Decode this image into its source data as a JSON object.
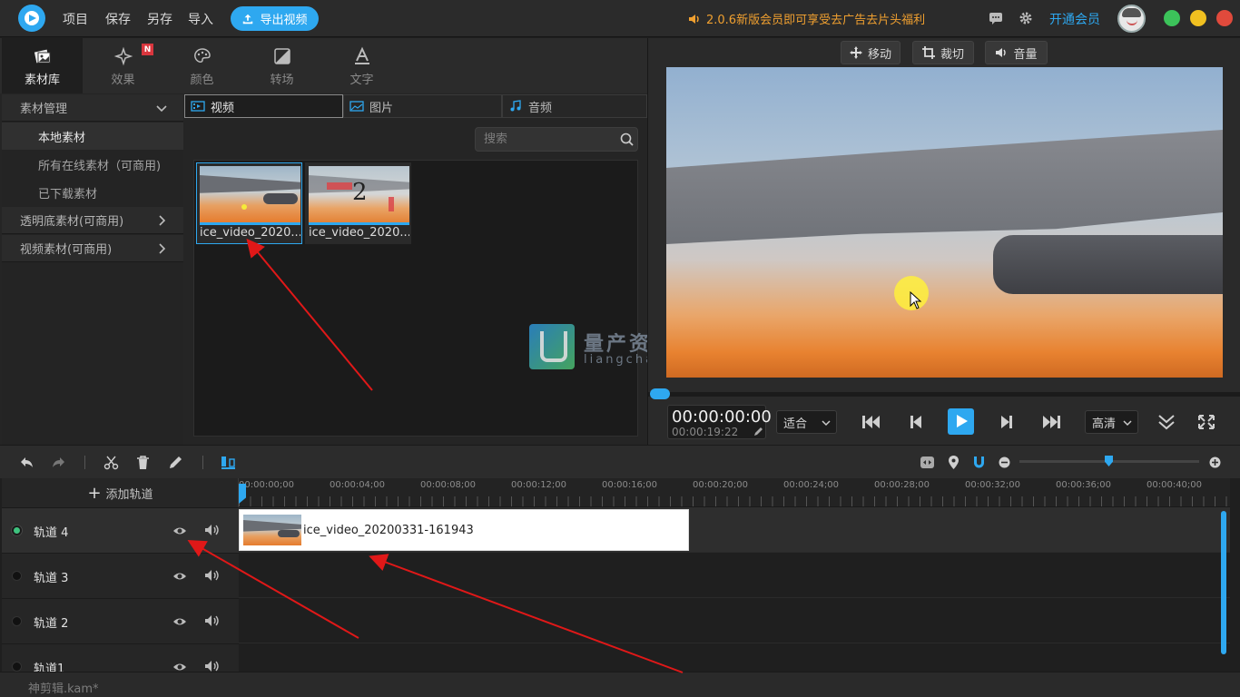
{
  "titlebar": {
    "menu": [
      "项目",
      "保存",
      "另存",
      "导入"
    ],
    "export_label": "导出视频",
    "promo": "2.0.6新版会员即可享受去广告去片头福利",
    "vip_label": "开通会员",
    "icons": [
      "speaker-icon",
      "chat-icon",
      "gear-icon",
      "avatar",
      "restore-icon",
      "minimize-icon",
      "close-icon"
    ],
    "colors": {
      "accent": "#2ea8f0",
      "promo": "#f0a030",
      "green": "#3cc35a",
      "yellow": "#f0c020",
      "red": "#e04a3c"
    }
  },
  "category_tabs": [
    {
      "label": "素材库",
      "icon": "library-icon",
      "active": true
    },
    {
      "label": "效果",
      "icon": "sparkle-icon",
      "badge": "N"
    },
    {
      "label": "颜色",
      "icon": "palette-icon"
    },
    {
      "label": "转场",
      "icon": "transition-icon"
    },
    {
      "label": "文字",
      "icon": "text-icon"
    }
  ],
  "tree": {
    "heads": [
      "素材管理",
      "透明底素材(可商用)",
      "视频素材(可商用)"
    ],
    "subs": [
      "本地素材",
      "所有在线素材（可商用)",
      "已下载素材"
    ]
  },
  "media_tabs": [
    {
      "label": "视频",
      "icon": "film-icon",
      "active": true
    },
    {
      "label": "图片",
      "icon": "image-icon"
    },
    {
      "label": "音频",
      "icon": "music-icon"
    }
  ],
  "search": {
    "placeholder": "搜索"
  },
  "media_items": [
    {
      "name": "ice_video_2020...",
      "selected": true
    },
    {
      "name": "ice_video_2020...",
      "selected": false,
      "overlay_text": "2"
    }
  ],
  "watermark": {
    "cn": "量产资源网",
    "en": "liangchan.net"
  },
  "preview": {
    "buttons": [
      {
        "label": "移动",
        "icon": "move-icon"
      },
      {
        "label": "裁切",
        "icon": "crop-icon"
      },
      {
        "label": "音量",
        "icon": "volume-icon"
      }
    ],
    "time_current": "00:00:00:00",
    "time_total": "00:00:19:22",
    "fit_label": "适合",
    "quality_label": "高清",
    "progress": 0.0
  },
  "timeline": {
    "add_track": "添加轨道",
    "ruler": [
      "00:00:00;00",
      "00:00:04;00",
      "00:00:08;00",
      "00:00:12;00",
      "00:00:16;00",
      "00:00:20;00",
      "00:00:24;00",
      "00:00:28;00",
      "00:00:32;00",
      "00:00:36;00",
      "00:00:40;00"
    ],
    "tracks": [
      {
        "name": "轨道 4",
        "active": true
      },
      {
        "name": "轨道 3",
        "active": false
      },
      {
        "name": "轨道 2",
        "active": false
      },
      {
        "name": "轨道1",
        "active": false
      }
    ],
    "clip_name": "ice_video_20200331-161943"
  },
  "status": {
    "project_file": "神剪辑.kam*"
  }
}
